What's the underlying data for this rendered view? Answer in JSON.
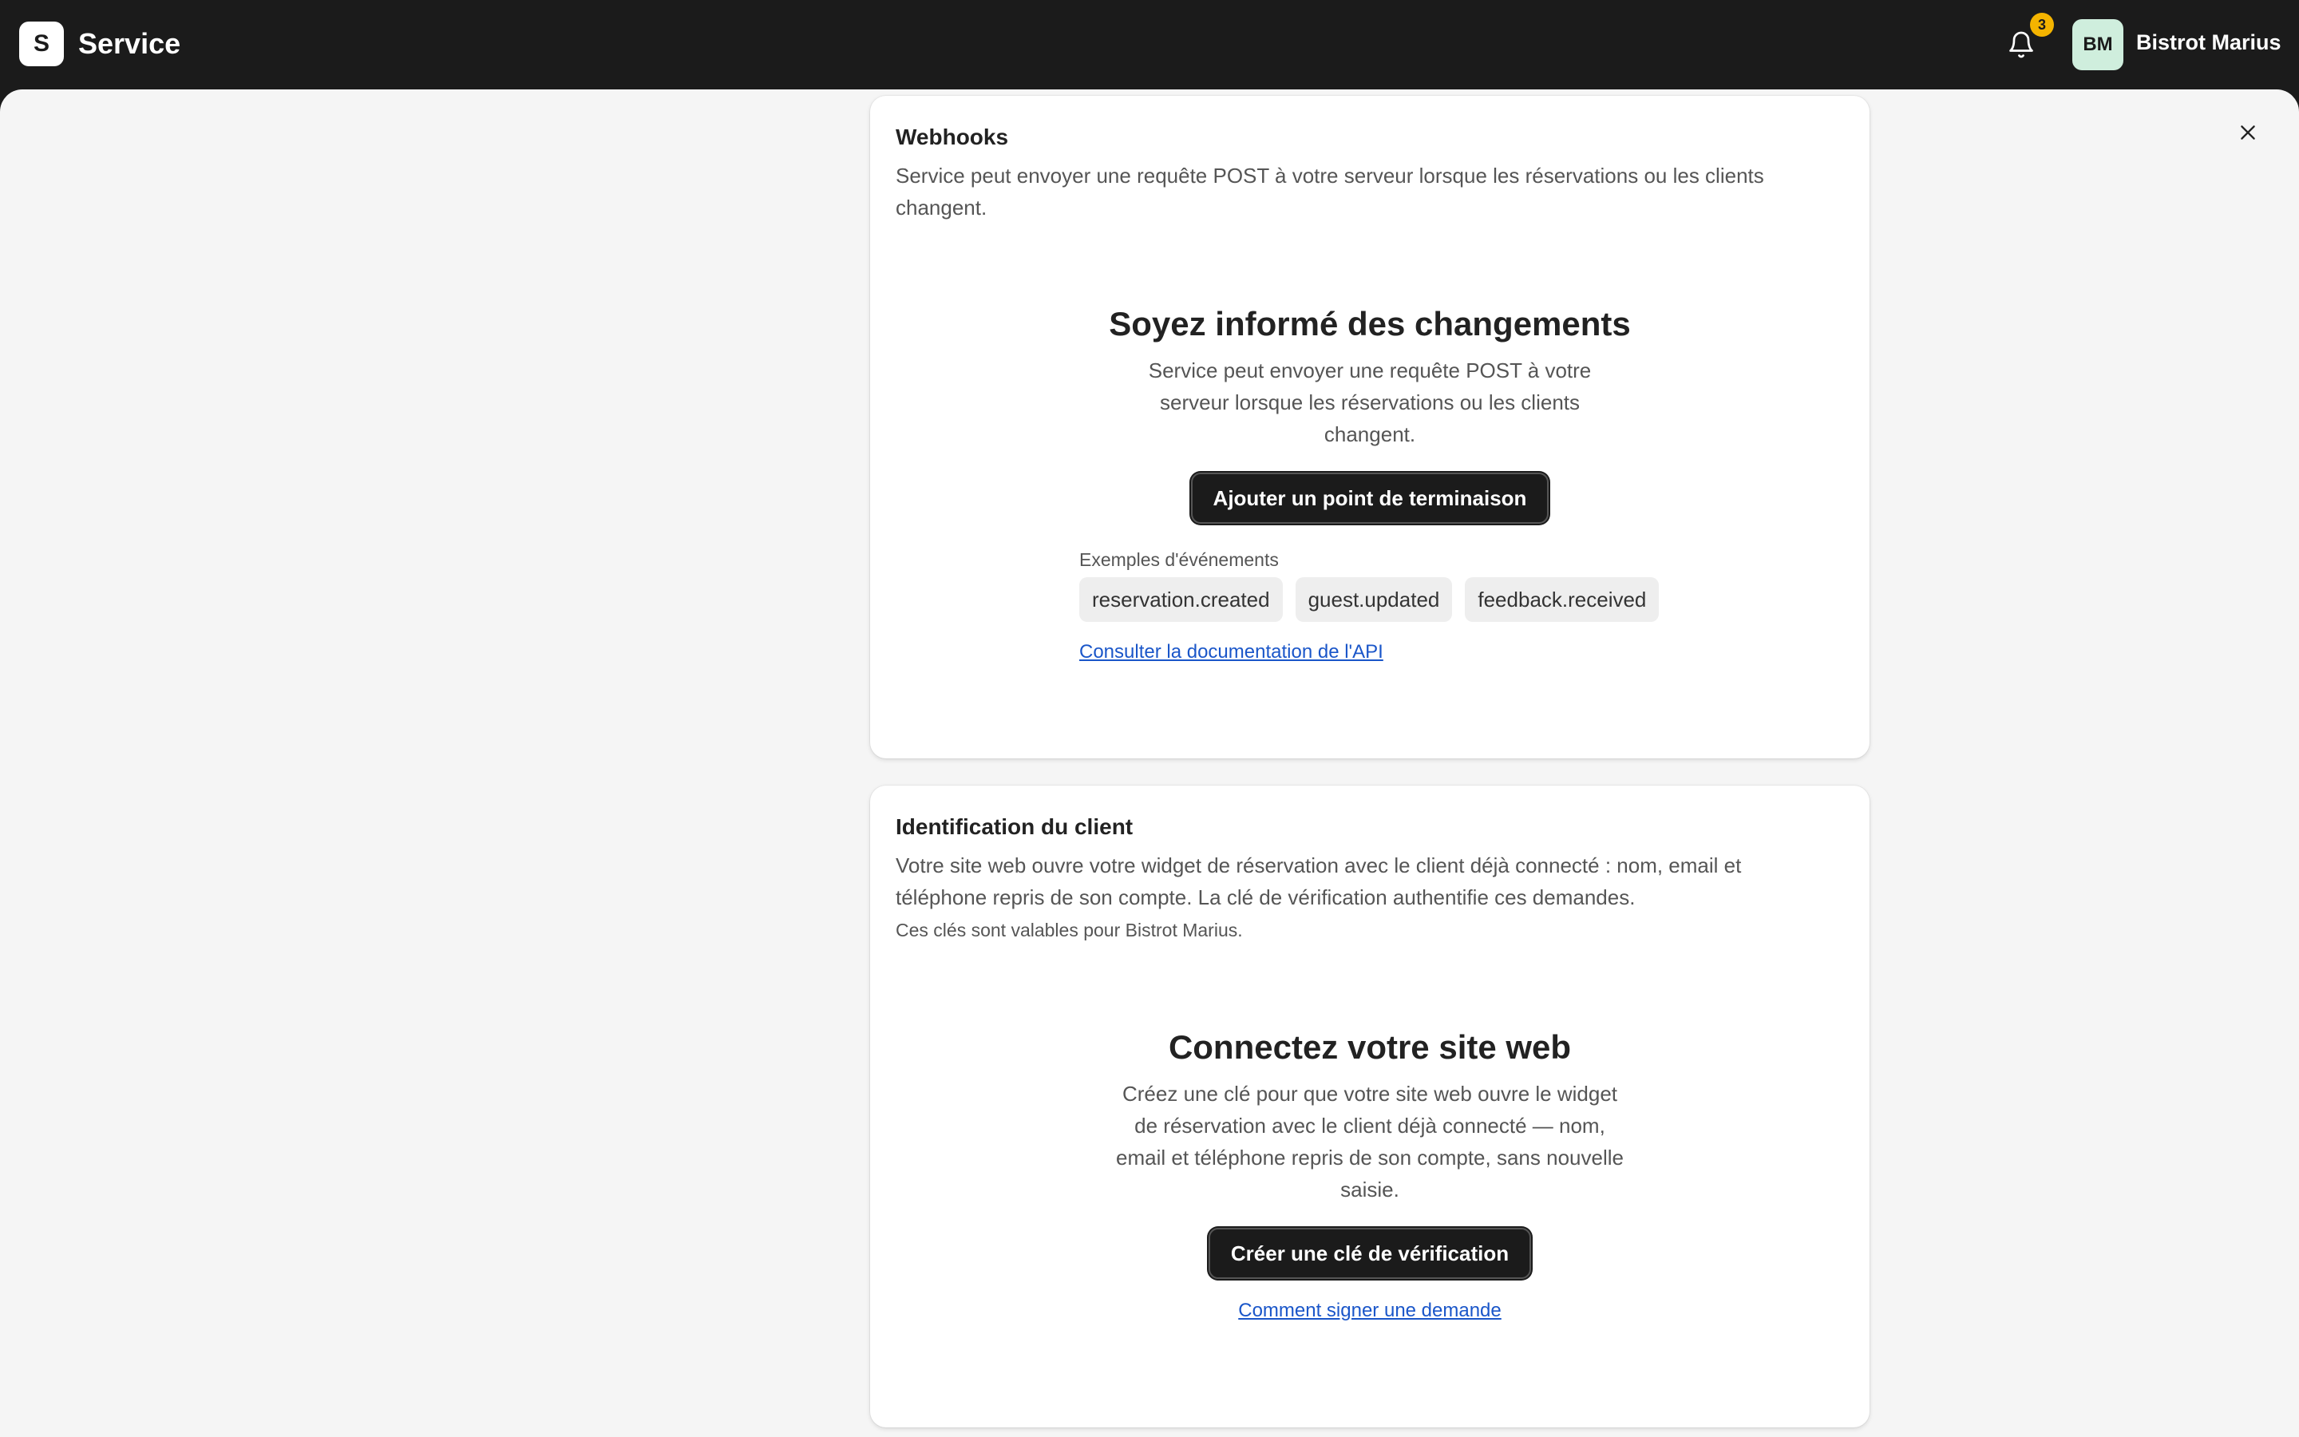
{
  "app": {
    "logo_letter": "S",
    "name": "Service"
  },
  "header": {
    "notifications_count": "3",
    "avatar_initials": "BM",
    "account_name": "Bistrot Marius"
  },
  "webhooks": {
    "title": "Webhooks",
    "description": "Service peut envoyer une requête POST à votre serveur lorsque les réservations ou les clients changent.",
    "empty_title": "Soyez informé des changements",
    "empty_text": "Service peut envoyer une requête POST à votre serveur lorsque les réservations ou les clients changent.",
    "add_button": "Ajouter un point de terminaison",
    "events_label": "Exemples d'événements",
    "events": [
      "reservation.created",
      "guest.updated",
      "feedback.received"
    ],
    "doc_link": "Consulter la documentation de l'API"
  },
  "identification": {
    "title": "Identification du client",
    "description": "Votre site web ouvre votre widget de réservation avec le client déjà connecté : nom, email et téléphone repris de son compte. La clé de vérification authentifie ces demandes.",
    "note": "Ces clés sont valables pour Bistrot Marius.",
    "empty_title": "Connectez votre site web",
    "empty_text": "Créez une clé pour que votre site web ouvre le widget de réservation avec le client déjà connecté — nom, email et téléphone repris de son compte, sans nouvelle saisie.",
    "create_button": "Créer une clé de vérification",
    "sign_link": "Comment signer une demande"
  },
  "colors": {
    "topbar": "#1b1b1b",
    "badge": "#f4b400",
    "avatar_bg": "#cfeedd",
    "link": "#1a56c9"
  }
}
